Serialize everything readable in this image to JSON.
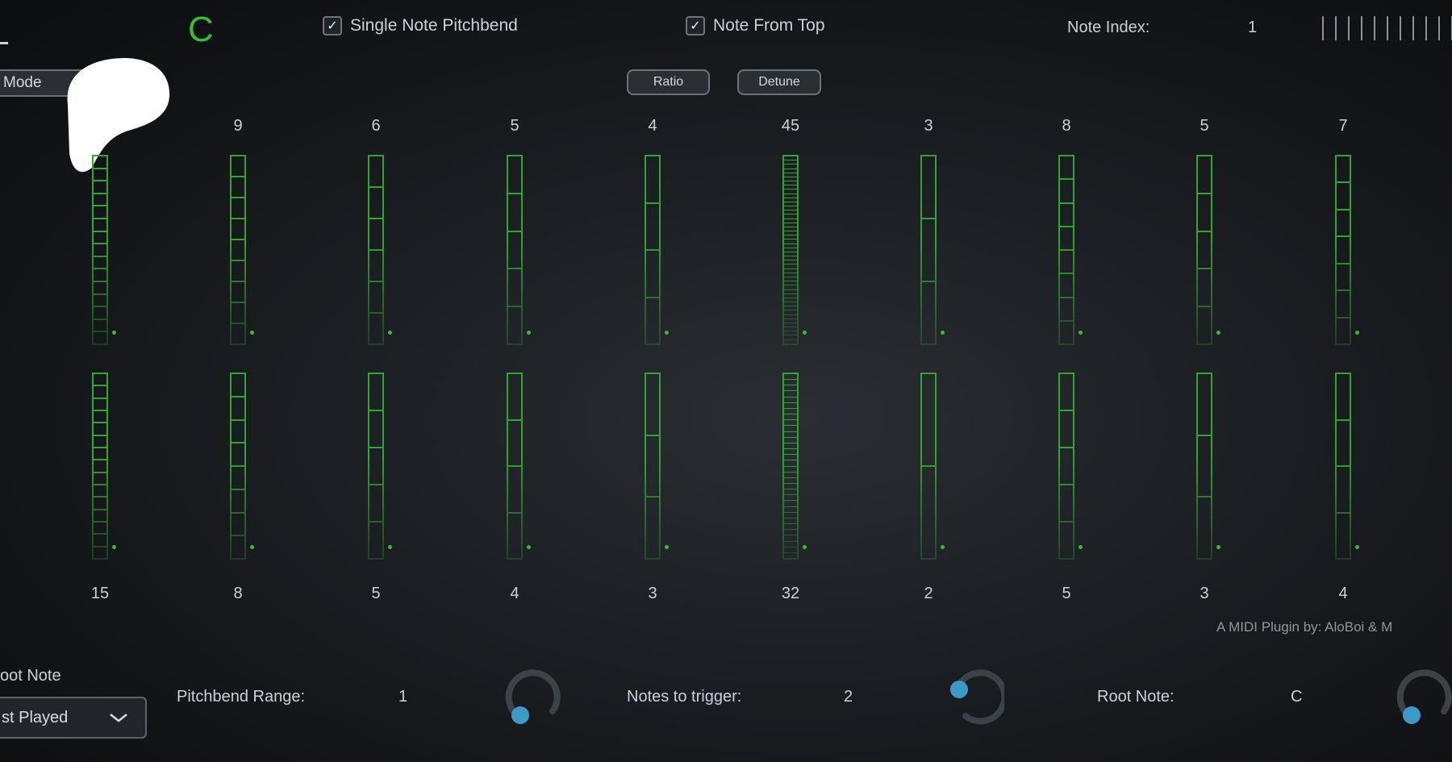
{
  "header": {
    "key_label": "C",
    "single_note_pitchbend": {
      "label": "Single Note Pitchbend",
      "checked": true
    },
    "note_from_top": {
      "label": "Note From Top",
      "checked": true
    },
    "note_index_label": "Note Index:",
    "note_index_value": "1",
    "mode_label": "Mode",
    "ratio_label": "Ratio",
    "detune_label": "Detune"
  },
  "columns": [
    {
      "top": "",
      "bottom": "15",
      "top_segments": 15,
      "bottom_segments": 15
    },
    {
      "top": "9",
      "bottom": "8",
      "top_segments": 9,
      "bottom_segments": 8
    },
    {
      "top": "6",
      "bottom": "5",
      "top_segments": 6,
      "bottom_segments": 5
    },
    {
      "top": "5",
      "bottom": "4",
      "top_segments": 5,
      "bottom_segments": 4
    },
    {
      "top": "4",
      "bottom": "3",
      "top_segments": 4,
      "bottom_segments": 3
    },
    {
      "top": "45",
      "bottom": "32",
      "top_segments": 45,
      "bottom_segments": 32
    },
    {
      "top": "3",
      "bottom": "2",
      "top_segments": 3,
      "bottom_segments": 2
    },
    {
      "top": "8",
      "bottom": "5",
      "top_segments": 8,
      "bottom_segments": 5
    },
    {
      "top": "5",
      "bottom": "3",
      "top_segments": 5,
      "bottom_segments": 3
    },
    {
      "top": "7",
      "bottom": "4",
      "top_segments": 7,
      "bottom_segments": 4
    }
  ],
  "credit": "A MIDI Plugin by:  AloBoi & M",
  "footer": {
    "root_note_heading": "oot Note",
    "root_note_dropdown_value": "st Played",
    "pitchbend_range_label": "Pitchbend Range:",
    "pitchbend_range_value": "1",
    "notes_to_trigger_label": "Notes to trigger:",
    "notes_to_trigger_value": "2",
    "root_note_label": "Root Note:",
    "root_note_value": "C"
  },
  "colors": {
    "accent_green": "#2ea82b",
    "key_green": "#2fc42b",
    "knob_blue": "#3a9bc9"
  },
  "icons": [
    "check-icon",
    "chevron-down-icon",
    "logo-icon"
  ]
}
